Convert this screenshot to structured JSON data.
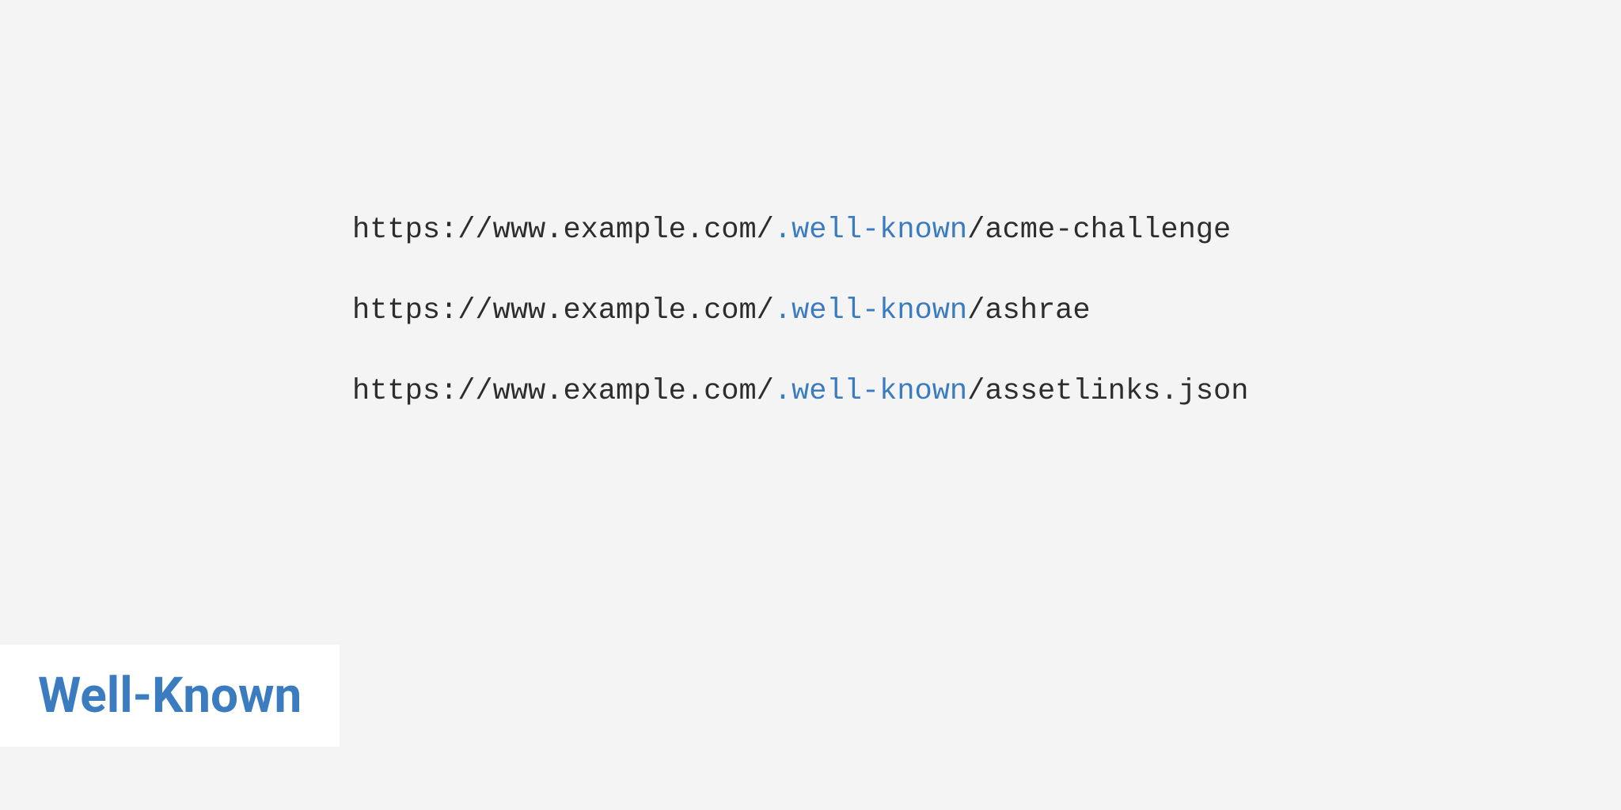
{
  "urls": [
    {
      "prefix": "https://www.example.com/",
      "highlight": ".well-known",
      "suffix": "/acme-challenge"
    },
    {
      "prefix": "https://www.example.com/",
      "highlight": ".well-known",
      "suffix": "/ashrae"
    },
    {
      "prefix": "https://www.example.com/",
      "highlight": ".well-known",
      "suffix": "/assetlinks.json"
    }
  ],
  "title": "Well-Known"
}
